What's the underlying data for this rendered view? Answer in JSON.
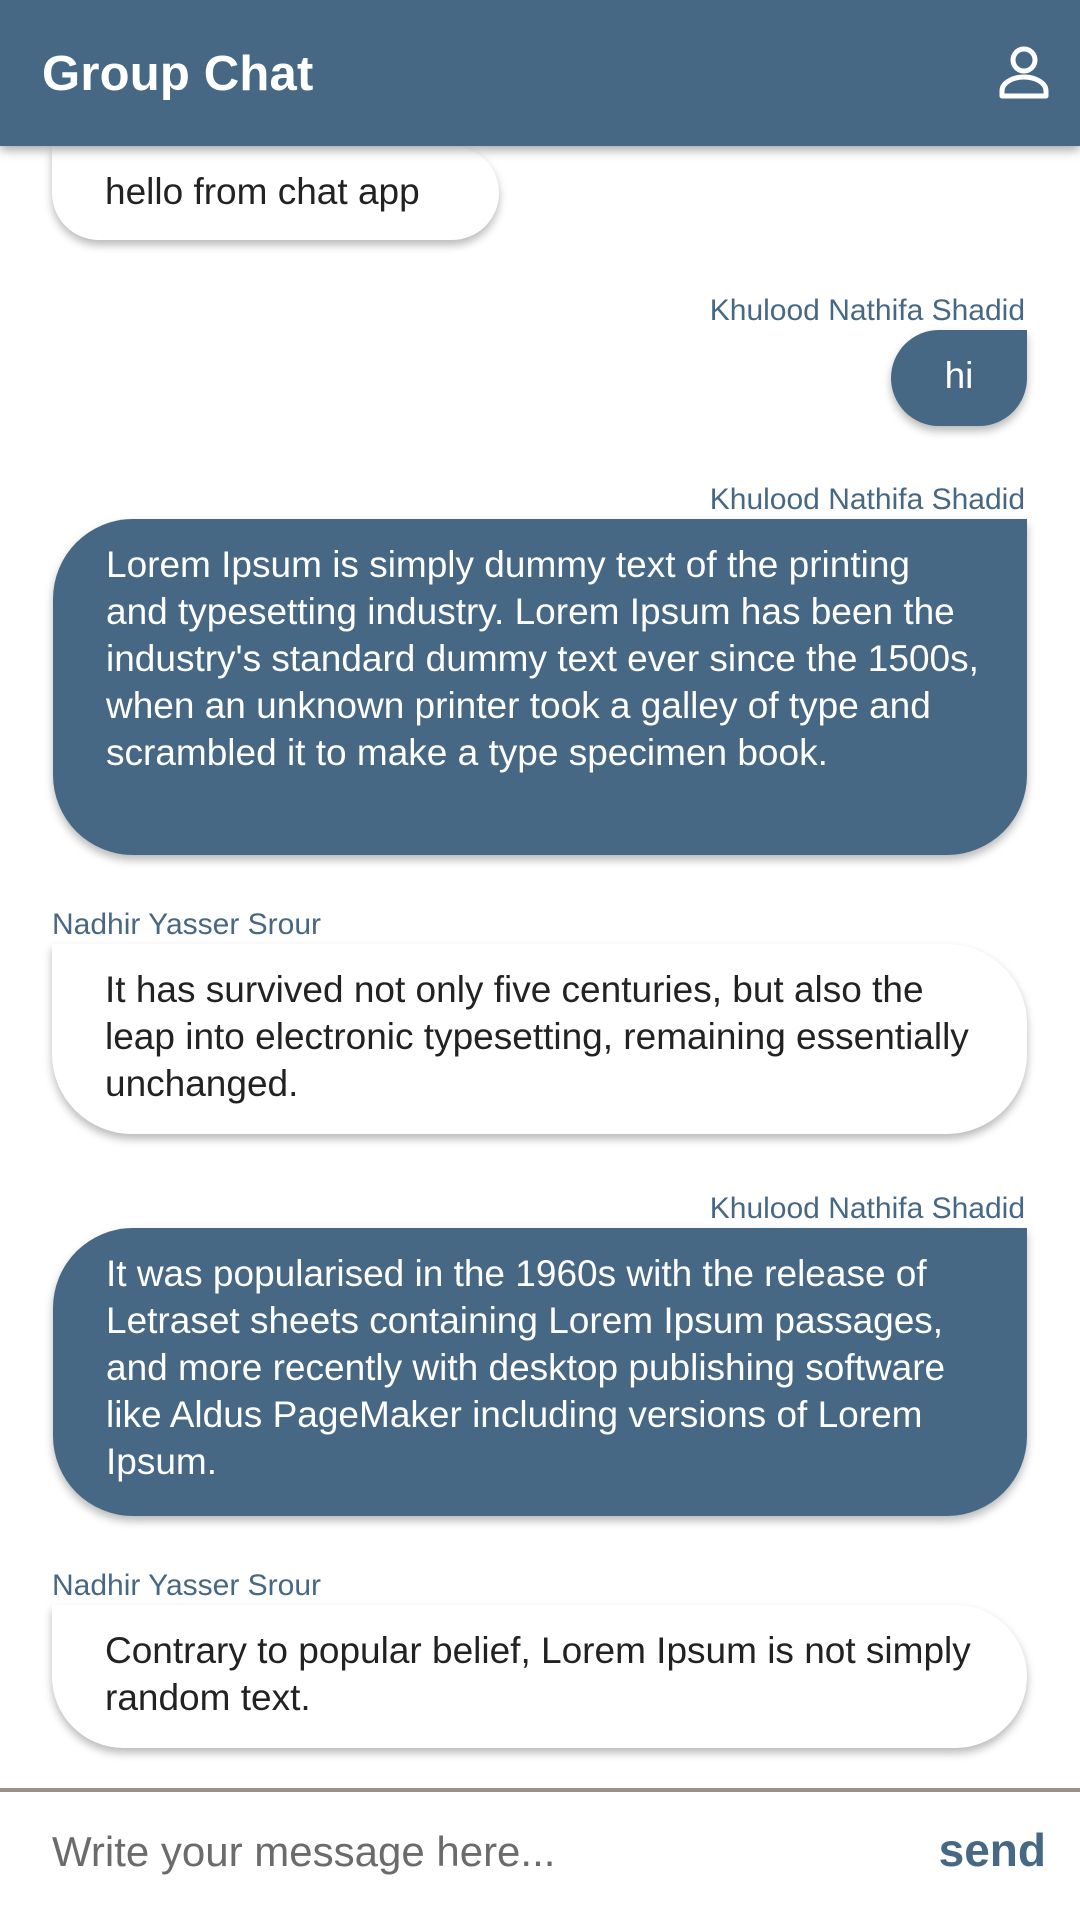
{
  "appbar": {
    "title": "Group Chat",
    "profile_icon": "person-outline-icon"
  },
  "messages": [
    {
      "direction": "incoming",
      "sender": "",
      "text": "hello from chat app"
    },
    {
      "direction": "outgoing",
      "sender": "Khulood Nathifa Shadid",
      "text": "hi"
    },
    {
      "direction": "outgoing",
      "sender": "Khulood Nathifa Shadid",
      "text": "Lorem Ipsum is simply dummy text of the printing and typesetting industry. Lorem Ipsum has been the industry's standard dummy text ever since the 1500s, when an unknown printer took a galley of type and scrambled it to make a type specimen book."
    },
    {
      "direction": "incoming",
      "sender": "Nadhir Yasser Srour",
      "text": "It has survived not only five centuries, but also the leap into electronic typesetting, remaining essentially unchanged."
    },
    {
      "direction": "outgoing",
      "sender": "Khulood Nathifa Shadid",
      "text": "It was popularised in the 1960s with the release of Letraset sheets containing Lorem Ipsum passages, and more recently with desktop publishing software like Aldus PageMaker including versions of Lorem Ipsum."
    },
    {
      "direction": "incoming",
      "sender": "Nadhir Yasser Srour",
      "text": "Contrary to popular belief, Lorem Ipsum is not simply random text."
    }
  ],
  "composer": {
    "placeholder": "Write your message here...",
    "value": "",
    "send_label": "send"
  },
  "colors": {
    "primary": "#476884",
    "divider": "#9b9089"
  }
}
